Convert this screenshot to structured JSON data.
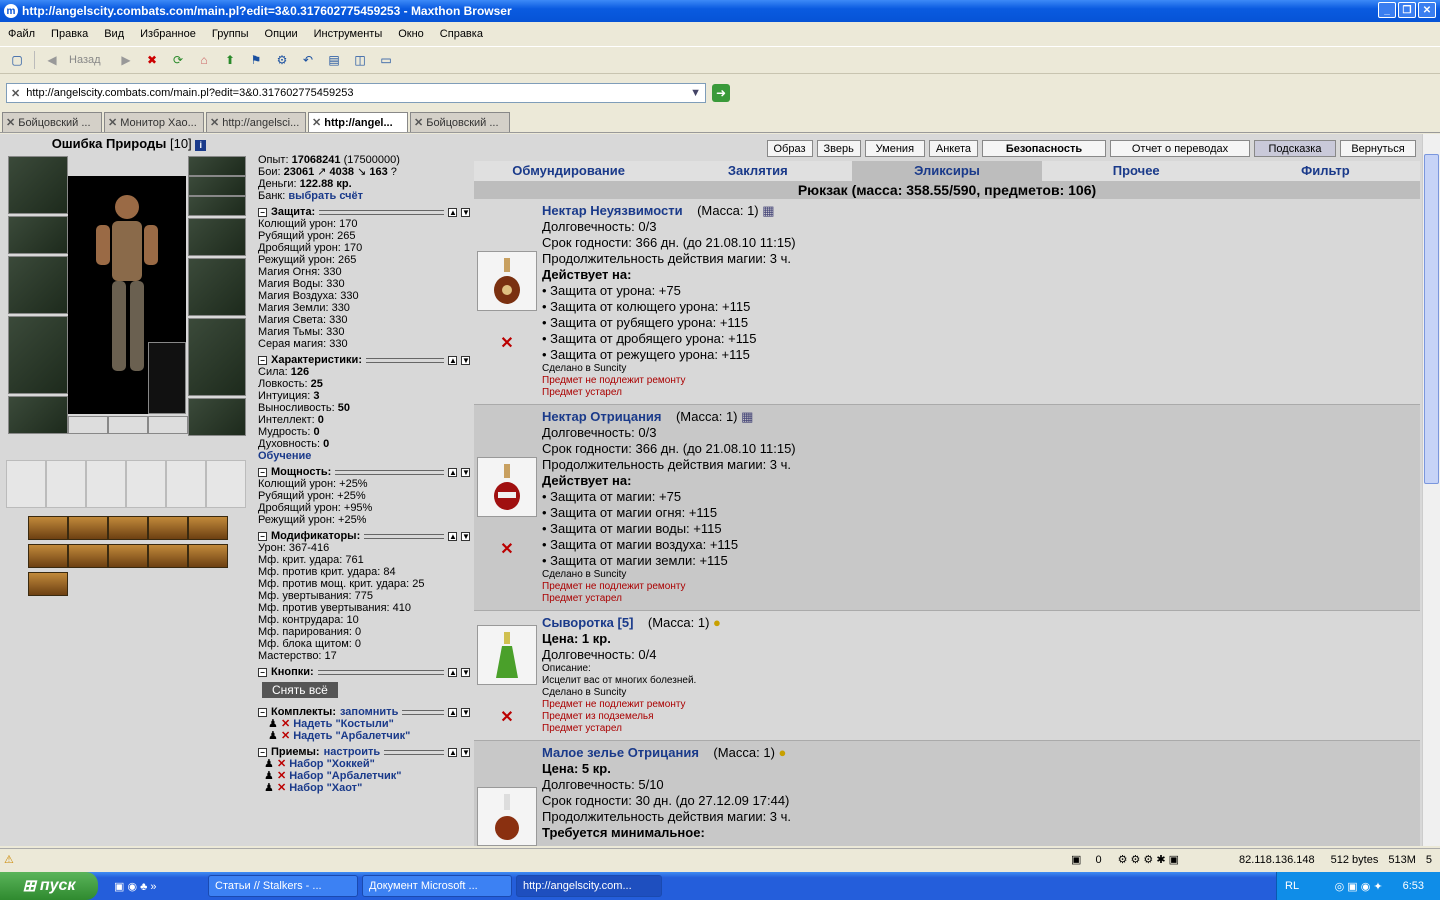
{
  "window": {
    "title": "http://angelscity.combats.com/main.pl?edit=3&0.317602775459253 - Maxthon Browser"
  },
  "menu": [
    "Файл",
    "Правка",
    "Вид",
    "Избранное",
    "Группы",
    "Опции",
    "Инструменты",
    "Окно",
    "Справка"
  ],
  "toolbar": {
    "back_label": "Назад"
  },
  "address": {
    "url": "http://angelscity.combats.com/main.pl?edit=3&0.317602775459253"
  },
  "tabs": [
    "Бойцовский ...",
    "Монитор Хао...",
    "http://angelsci...",
    "http://angel...",
    "Бойцовский ..."
  ],
  "character": {
    "name": "Ошибка Природы",
    "level": "[10]"
  },
  "summary": {
    "exp_label": "Опыт:",
    "exp": "17068241",
    "exp_next": "(17500000)",
    "fights_label": "Бои:",
    "wins": "23061",
    "losses": "4038",
    "draws": "163",
    "money_label": "Деньги:",
    "money": "122.88 кр.",
    "bank_label": "Банк:",
    "bank_link": "выбрать счёт"
  },
  "sections": {
    "protection": "Защита:",
    "characteristics": "Характеристики:",
    "power": "Мощность:",
    "modifiers": "Модификаторы:",
    "buttons": "Кнопки:",
    "sets": "Комплекты:",
    "sets_link": "запомнить",
    "techniques": "Приемы:",
    "techniques_link": "настроить"
  },
  "protection": [
    "Колющий урон: 170",
    "Рубящий урон: 265",
    "Дробящий урон: 170",
    "Режущий урон: 265",
    "Магия Огня: 330",
    "Магия Воды: 330",
    "Магия Воздуха: 330",
    "Магия Земли: 330",
    "Магия Света: 330",
    "Магия Тьмы: 330",
    "Серая магия: 330"
  ],
  "characteristics": [
    {
      "label": "Сила:",
      "value": "126"
    },
    {
      "label": "Ловкость:",
      "value": "25"
    },
    {
      "label": "Интуиция:",
      "value": "3"
    },
    {
      "label": "Выносливость:",
      "value": "50"
    },
    {
      "label": "Интеллект:",
      "value": "0"
    },
    {
      "label": "Мудрость:",
      "value": "0"
    },
    {
      "label": "Духовность:",
      "value": "0"
    }
  ],
  "training_link": "Обучение",
  "power": [
    "Колющий урон: +25%",
    "Рубящий урон: +25%",
    "Дробящий урон: +95%",
    "Режущий урон: +25%"
  ],
  "modifiers": [
    "Урон: 367-416",
    "Мф. крит. удара: 761",
    "Мф. против крит. удара: 84",
    "Мф. против мощ. крит. удара: 25",
    "Мф. увертывания: 775",
    "Мф. против увертывания: 410",
    "Мф. контрудара: 10",
    "Мф. парирования: 0",
    "Мф. блока щитом: 0",
    "Мастерство: 17"
  ],
  "remove_all": "Снять всё",
  "sets": [
    "Надеть \"Костыли\"",
    "Надеть \"Арбалетчик\""
  ],
  "techniques": [
    "Набор \"Хоккей\"",
    "Набор \"Арбалетчик\"",
    "Набор \"Хаот\""
  ],
  "topbuttons": [
    "Образ",
    "Зверь",
    "Умения",
    "Анкета",
    "Безопасность",
    "Отчет о переводах",
    "Подсказка",
    "Вернуться"
  ],
  "invtabs": [
    "Обмундирование",
    "Заклятия",
    "Эликсиры",
    "Прочее",
    "Фильтр"
  ],
  "backpack": "Рюкзак (масса: 358.55/590, предметов: 106)",
  "items": [
    {
      "name": "Нектар Неуязвимости",
      "mass": "(Масса: 1)",
      "lines": [
        "Долговечность: 0/3",
        "Срок годности: 366 дн. (до 21.08.10 11:15)",
        "Продолжительность действия магии: 3 ч."
      ],
      "acts": "Действует на:",
      "effects": [
        "• Защита от урона: +75",
        "• Защита от колющего урона: +115",
        "• Защита от рубящего урона: +115",
        "• Защита от дробящего урона: +115",
        "• Защита от режущего урона: +115"
      ],
      "made": "Сделано в Suncity",
      "notes": [
        "Предмет не подлежит ремонту",
        "Предмет устарел"
      ]
    },
    {
      "name": "Нектар Отрицания",
      "mass": "(Масса: 1)",
      "lines": [
        "Долговечность: 0/3",
        "Срок годности: 366 дн. (до 21.08.10 11:15)",
        "Продолжительность действия магии: 3 ч."
      ],
      "acts": "Действует на:",
      "effects": [
        "• Защита от магии: +75",
        "• Защита от магии огня: +115",
        "• Защита от магии воды: +115",
        "• Защита от магии воздуха: +115",
        "• Защита от магии земли: +115"
      ],
      "made": "Сделано в Suncity",
      "notes": [
        "Предмет не подлежит ремонту",
        "Предмет устарел"
      ]
    },
    {
      "name": "Сыворотка [5]",
      "mass": "(Масса: 1)",
      "price": "Цена: 1 кр.",
      "lines": [
        "Долговечность: 0/4"
      ],
      "desc_label": "Описание:",
      "desc": "Исцелит вас от многих болезней.",
      "made": "Сделано в Suncity",
      "notes": [
        "Предмет не подлежит ремонту",
        "Предмет из подземелья",
        "Предмет устарел"
      ]
    },
    {
      "name": "Малое зелье Отрицания",
      "mass": "(Масса: 1)",
      "price": "Цена: 5 кр.",
      "lines": [
        "Долговечность: 5/10",
        "Срок годности: 30 дн. (до 27.12.09 17:44)",
        "Продолжительность действия магии: 3 ч."
      ],
      "req": "Требуется минимальное:"
    }
  ],
  "status": {
    "count": "0",
    "ip": "82.118.136.148",
    "bytes": "512 bytes",
    "mem": "513M",
    "n": "5"
  },
  "taskbar": {
    "start": "пуск",
    "tasks": [
      "Статьи // Stalkers - ...",
      "Документ Microsoft ...",
      "http://angelscity.com..."
    ],
    "lang": "RL",
    "time": "6:53"
  },
  "colors": {
    "link": "#1a3a8a",
    "alert": "#aa0000",
    "xp_blue": "#0653d6"
  }
}
